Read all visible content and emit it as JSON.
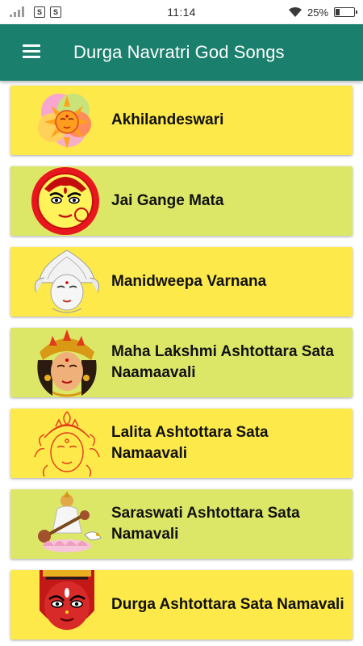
{
  "status_bar": {
    "time": "11:14",
    "battery_percent": "25%",
    "battery_level": 0.25,
    "notification_icons": [
      "S",
      "S"
    ]
  },
  "app_bar": {
    "title": "Durga Navratri God Songs",
    "menu_icon": "hamburger-menu-icon",
    "background": "#1a7f6c"
  },
  "colors": {
    "card_yellow": "#fde94a",
    "card_lime": "#dce768"
  },
  "songs": [
    {
      "label": "Akhilandeswari",
      "bg": "#fde94a",
      "thumb": "sun-goddess-flower-image"
    },
    {
      "label": "Jai Gange Mata",
      "bg": "#dce768",
      "thumb": "durga-face-circle-image"
    },
    {
      "label": "Manidweepa Varnana",
      "bg": "#fde94a",
      "thumb": "goddess-crown-white-image"
    },
    {
      "label": "Maha Lakshmi Ashtottara Sata Naamaavali",
      "bg": "#dce768",
      "thumb": "lakshmi-face-image"
    },
    {
      "label": "Lalita Ashtottara Sata Namaavali",
      "bg": "#fde94a",
      "thumb": "lalita-line-art-image"
    },
    {
      "label": "Saraswati Ashtottara Sata Namavali",
      "bg": "#dce768",
      "thumb": "saraswati-veena-image"
    },
    {
      "label": "Durga Ashtottara Sata Namavali",
      "bg": "#fde94a",
      "thumb": "durga-red-face-image"
    }
  ]
}
